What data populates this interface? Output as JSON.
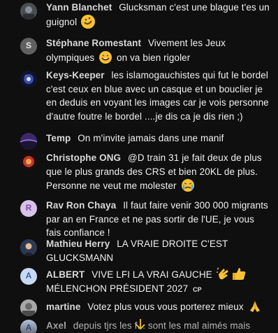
{
  "messages": [
    {
      "author": "Yann Blanchet",
      "text": "Glucksman c'est une blague t'es un guignol",
      "emoji": "rofl-emoji"
    },
    {
      "author": "Stéphane Romestant",
      "initial": "S",
      "text_before": "Vivement les Jeux olympiques",
      "emoji": "grin-emoji",
      "text_after": "on va bien rigoler"
    },
    {
      "author": "Keys-Keeper",
      "text": "les islamogauchistes qui fut le bordel c'est ceux en blue avec un casque et un bouclier je en deduis en voyant les images car je vois personne d'autre foutre le bordel ....je dis ca je dis rien ;)"
    },
    {
      "author": "Temp",
      "text": "On m'invite jamais dans une manif"
    },
    {
      "author": "Christophe ONG",
      "text": "@D train 31 je fait deux de plus que le plus grands des CRS et bien 20KL de plus. Personne ne veut me molester",
      "emoji": "crying-emoji"
    },
    {
      "author": "Rav Ron Chaya",
      "initial": "R",
      "text": "Il faut faire venir 300 000 migrants par an en France et ne pas sortir de l'UE, je vous fais confiance !"
    },
    {
      "author": "Mathieu Herry",
      "text": "LA VRAIE DROITE C'EST GLUCKSMANN"
    },
    {
      "author": "ALBERT",
      "initial": "A",
      "text_before": "VIVE LFI LA VRAI GAUCHE",
      "emoji": "clap-thumbs-emoji",
      "text_after": "MÉLENCHON PRÉSIDENT 2027",
      "badge": "CP"
    },
    {
      "author": "martine",
      "text": "Votez plus vous vous porterez mieux",
      "emoji": "folded-hands-emoji"
    },
    {
      "author": "Axel",
      "initial": "A",
      "text": "depuis tjrs les f... sont les mal aimés mais"
    }
  ],
  "colors": {
    "background": "#0f0f0f",
    "author": "#d9d9d9",
    "text": "#f1f1f1",
    "emoji_yellow": "#f7c234",
    "scroll_arrow": "#f5c518"
  },
  "icons": {
    "scroll_down": "arrow-down-icon"
  }
}
